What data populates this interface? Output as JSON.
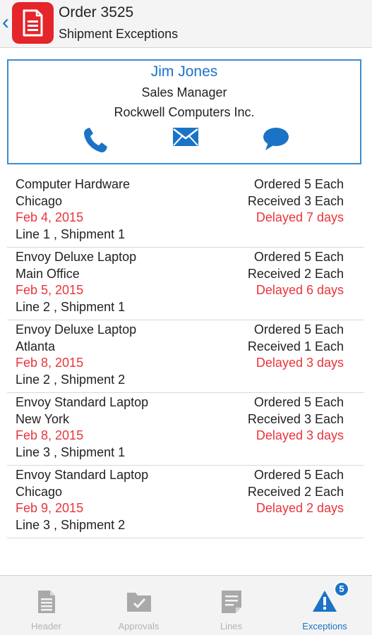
{
  "header": {
    "title": "Order 3525",
    "subtitle": "Shipment Exceptions",
    "back_icon": "chevron-left-icon",
    "app_icon": "document-icon",
    "colors": {
      "accent": "#1a73c6",
      "app_icon_bg": "#e4252a",
      "alert": "#e8353b"
    }
  },
  "contact": {
    "name": "Jim Jones",
    "role": "Sales Manager",
    "company": "Rockwell Computers Inc.",
    "actions": [
      "phone-icon",
      "mail-icon",
      "chat-icon"
    ]
  },
  "exceptions": [
    {
      "item": "Computer Hardware",
      "location": "Chicago",
      "date": "Feb 4, 2015",
      "line": "Line 1 , Shipment 1",
      "ordered": "Ordered 5 Each",
      "received": "Received 3 Each",
      "delay": "Delayed 7 days"
    },
    {
      "item": "Envoy Deluxe Laptop",
      "location": "Main Office",
      "date": "Feb 5, 2015",
      "line": "Line 2 , Shipment 1",
      "ordered": "Ordered 5 Each",
      "received": "Received 2 Each",
      "delay": "Delayed 6 days"
    },
    {
      "item": "Envoy Deluxe Laptop",
      "location": "Atlanta",
      "date": "Feb 8, 2015",
      "line": "Line 2 , Shipment 2",
      "ordered": "Ordered 5 Each",
      "received": "Received 1 Each",
      "delay": "Delayed 3 days"
    },
    {
      "item": "Envoy Standard Laptop",
      "location": "New York",
      "date": "Feb 8, 2015",
      "line": "Line 3 , Shipment 1",
      "ordered": "Ordered 5 Each",
      "received": "Received 3 Each",
      "delay": "Delayed 3 days"
    },
    {
      "item": "Envoy Standard Laptop",
      "location": "Chicago",
      "date": "Feb 9, 2015",
      "line": "Line 3 , Shipment 2",
      "ordered": "Ordered 5 Each",
      "received": "Received 2 Each",
      "delay": "Delayed 2 days"
    }
  ],
  "tabs": [
    {
      "label": "Header",
      "icon": "document-icon",
      "active": false
    },
    {
      "label": "Approvals",
      "icon": "folder-check-icon",
      "active": false
    },
    {
      "label": "Lines",
      "icon": "lines-icon",
      "active": false
    },
    {
      "label": "Exceptions",
      "icon": "warning-icon",
      "active": true,
      "badge": "5"
    }
  ]
}
